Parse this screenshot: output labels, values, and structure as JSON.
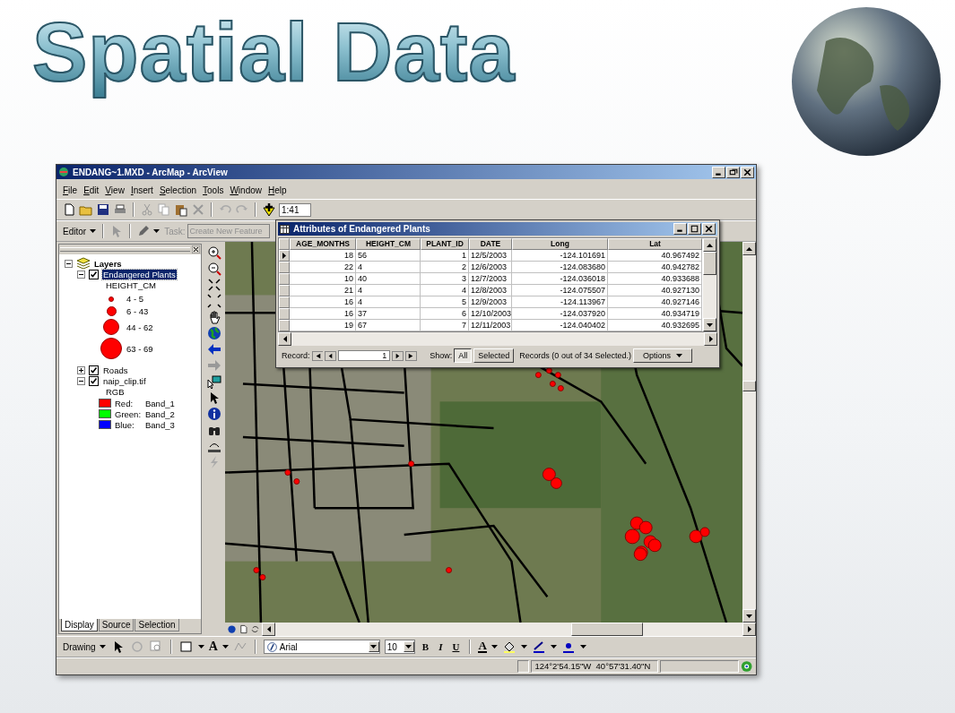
{
  "slide_title": "Spatial Data",
  "window": {
    "title": "ENDANG~1.MXD - ArcMap - ArcView",
    "menu": [
      "File",
      "Edit",
      "View",
      "Insert",
      "Selection",
      "Tools",
      "Window",
      "Help"
    ],
    "scale": "1:41",
    "editor": "Editor",
    "task_label": "Task:",
    "task_placeholder": "Create New Feature"
  },
  "toc": {
    "root": "Layers",
    "layers": [
      {
        "name": "Endangered Plants",
        "checked": true,
        "expanded": true,
        "selected": true,
        "kind": "points",
        "heading": "HEIGHT_CM",
        "classes": [
          "4 - 5",
          "6 - 43",
          "44 - 62",
          "63 - 69"
        ]
      },
      {
        "name": "Roads",
        "checked": true,
        "expanded": false,
        "selected": false
      },
      {
        "name": "naip_clip.tif",
        "checked": true,
        "expanded": true,
        "selected": false,
        "kind": "raster",
        "heading": "RGB",
        "bands": [
          {
            "channel": "Red:",
            "band": "Band_1",
            "color": "#ff0000"
          },
          {
            "channel": "Green:",
            "band": "Band_2",
            "color": "#00ff00"
          },
          {
            "channel": "Blue:",
            "band": "Band_3",
            "color": "#0000ff"
          }
        ]
      }
    ],
    "tabs": [
      {
        "label": "Display",
        "selected": true
      },
      {
        "label": "Source",
        "selected": false
      },
      {
        "label": "Selection",
        "selected": false
      }
    ]
  },
  "attributes": {
    "title": "Attributes of Endangered Plants",
    "columns": [
      "AGE_MONTHS",
      "HEIGHT_CM",
      "PLANT_ID",
      "DATE",
      "Long",
      "Lat"
    ],
    "rows": [
      {
        "current": true,
        "cells": [
          "18",
          "56",
          "1",
          "12/5/2003",
          "-124.101691",
          "40.967492"
        ]
      },
      {
        "current": false,
        "cells": [
          "22",
          "4",
          "2",
          "12/6/2003",
          "-124.083680",
          "40.942782"
        ]
      },
      {
        "current": false,
        "cells": [
          "10",
          "40",
          "3",
          "12/7/2003",
          "-124.036018",
          "40.933688"
        ]
      },
      {
        "current": false,
        "cells": [
          "21",
          "4",
          "4",
          "12/8/2003",
          "-124.075507",
          "40.927130"
        ]
      },
      {
        "current": false,
        "cells": [
          "16",
          "4",
          "5",
          "12/9/2003",
          "-124.113967",
          "40.927146"
        ]
      },
      {
        "current": false,
        "cells": [
          "16",
          "37",
          "6",
          "12/10/2003",
          "-124.037920",
          "40.934719"
        ]
      },
      {
        "current": false,
        "cells": [
          "19",
          "67",
          "7",
          "12/11/2003",
          "-124.040402",
          "40.932695"
        ]
      }
    ],
    "record_label": "Record:",
    "record_value": "1",
    "show_label": "Show:",
    "show_buttons": [
      {
        "label": "All",
        "selected": true
      },
      {
        "label": "Selected",
        "selected": false
      }
    ],
    "status": "Records (0 out of 34 Selected.)",
    "options": "Options"
  },
  "drawing": {
    "label": "Drawing",
    "text_tool": "A",
    "font": "Arial",
    "size": "10",
    "format_buttons": [
      "B",
      "I",
      "U"
    ],
    "font_color": "A"
  },
  "status_bar": {
    "coordinates": "124°2'54.15\"W  40°57'31.40\"N"
  }
}
